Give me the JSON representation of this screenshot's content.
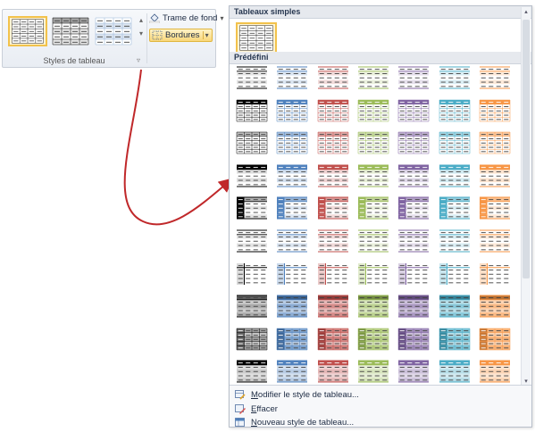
{
  "ribbon": {
    "group_label": "Styles de tableau",
    "shading_label": "Trame de fond",
    "borders_label": "Bordures",
    "shading_dropdown": "▾",
    "borders_dropdown": "▾",
    "gallery_scroll_up": "▴",
    "gallery_scroll_down": "▾",
    "gallery_more": "▿",
    "gallery_thumbs": [
      {
        "style": "grid-plain",
        "selected": true
      },
      {
        "style": "grid-gray-header",
        "selected": false
      },
      {
        "style": "grid-blue-light",
        "selected": false
      }
    ]
  },
  "panel": {
    "section_simple": "Tableaux simples",
    "section_predefined": "Prédéfini",
    "row_styles": [
      "header-rule",
      "full-grid",
      "grid-lines",
      "solid-header",
      "accent-column",
      "light-list",
      "first-column",
      "medium-shading",
      "colorful-grid",
      "dark-header"
    ],
    "column_colors": [
      "#7f7f7f",
      "#4f81bd",
      "#c0504d",
      "#9bbb59",
      "#8064a2",
      "#4bacc6",
      "#f79646"
    ],
    "footer": [
      {
        "prefix": "",
        "underline": "M",
        "rest": "odifier le style de tableau..."
      },
      {
        "prefix": "",
        "underline": "E",
        "rest": "ffacer"
      },
      {
        "prefix": "",
        "underline": "N",
        "rest": "ouveau style de tableau..."
      }
    ],
    "scroll_up": "▴",
    "scroll_down": "▾"
  },
  "colors": {
    "selection_border": "#f2c24b",
    "selection_fill": "#fff4d3",
    "arrow": "#c0282a"
  }
}
